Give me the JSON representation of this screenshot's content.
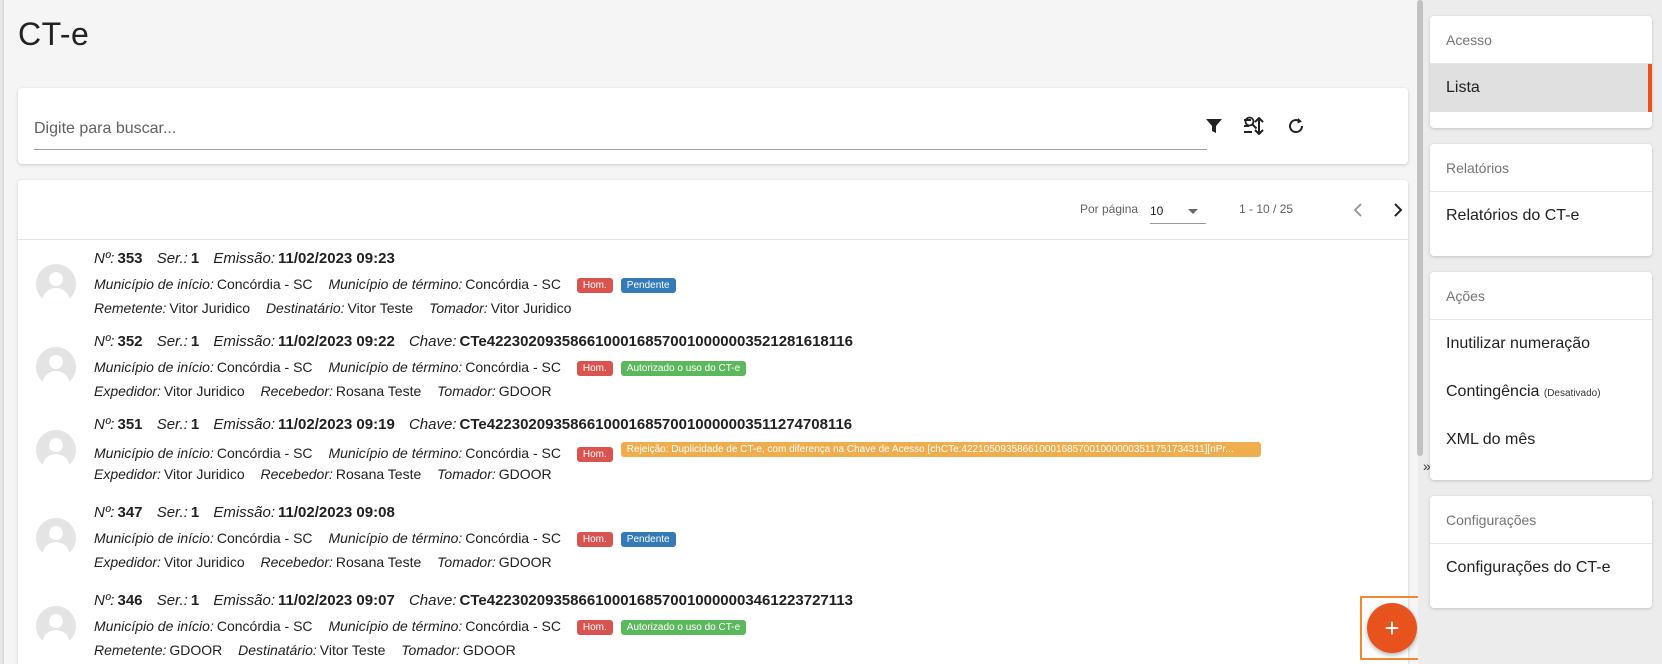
{
  "page": {
    "title": "CT-e"
  },
  "search": {
    "placeholder": "Digite para buscar..."
  },
  "pager": {
    "per_page_label": "Por página",
    "per_page_value": "10",
    "range": "1 - 10 / 25"
  },
  "items": [
    {
      "numero_label": "Nº:",
      "numero": "353",
      "serie_label": "Ser.:",
      "serie": "1",
      "emissao_label": "Emissão:",
      "emissao": "11/02/2023 09:23",
      "chave_label": "",
      "chave": "",
      "mun_inicio_label": "Município de início:",
      "mun_inicio": "Concórdia - SC",
      "mun_termino_label": "Município de término:",
      "mun_termino": "Concórdia - SC",
      "badge_env": "Hom.",
      "status": "Pendente",
      "p1_label": "Remetente:",
      "p1": "Vitor Juridico",
      "p2_label": "Destinatário:",
      "p2": "Vitor Teste",
      "p3_label": "Tomador:",
      "p3": "Vitor Juridico"
    },
    {
      "numero_label": "Nº:",
      "numero": "352",
      "serie_label": "Ser.:",
      "serie": "1",
      "emissao_label": "Emissão:",
      "emissao": "11/02/2023 09:22",
      "chave_label": "Chave:",
      "chave": "CTe42230209358661000168570010000003521281618116",
      "mun_inicio_label": "Município de início:",
      "mun_inicio": "Concórdia - SC",
      "mun_termino_label": "Município de término:",
      "mun_termino": "Concórdia - SC",
      "badge_env": "Hom.",
      "status": "Autorizado o uso do CT-e",
      "p1_label": "Expedidor:",
      "p1": "Vitor Juridico",
      "p2_label": "Recebedor:",
      "p2": "Rosana Teste",
      "p3_label": "Tomador:",
      "p3": "GDOOR"
    },
    {
      "numero_label": "Nº:",
      "numero": "351",
      "serie_label": "Ser.:",
      "serie": "1",
      "emissao_label": "Emissão:",
      "emissao": "11/02/2023 09:19",
      "chave_label": "Chave:",
      "chave": "CTe42230209358661000168570010000003511274708116",
      "mun_inicio_label": "Município de início:",
      "mun_inicio": "Concórdia - SC",
      "mun_termino_label": "Município de término:",
      "mun_termino": "Concórdia - SC",
      "badge_env": "Hom.",
      "status": "Rejeição: Duplicidade de CT-e, com diferença na Chave de Acesso [chCTe:42210509358661000168570010000003511751734311][nPr...",
      "p1_label": "Expedidor:",
      "p1": "Vitor Juridico",
      "p2_label": "Recebedor:",
      "p2": "Rosana Teste",
      "p3_label": "Tomador:",
      "p3": "GDOOR"
    },
    {
      "numero_label": "Nº:",
      "numero": "347",
      "serie_label": "Ser.:",
      "serie": "1",
      "emissao_label": "Emissão:",
      "emissao": "11/02/2023 09:08",
      "chave_label": "",
      "chave": "",
      "mun_inicio_label": "Município de início:",
      "mun_inicio": "Concórdia - SC",
      "mun_termino_label": "Município de término:",
      "mun_termino": "Concórdia - SC",
      "badge_env": "Hom.",
      "status": "Pendente",
      "p1_label": "Expedidor:",
      "p1": "Vitor Juridico",
      "p2_label": "Recebedor:",
      "p2": "Rosana Teste",
      "p3_label": "Tomador:",
      "p3": "GDOOR"
    },
    {
      "numero_label": "Nº:",
      "numero": "346",
      "serie_label": "Ser.:",
      "serie": "1",
      "emissao_label": "Emissão:",
      "emissao": "11/02/2023 09:07",
      "chave_label": "Chave:",
      "chave": "CTe42230209358661000168570010000003461223727113",
      "mun_inicio_label": "Município de início:",
      "mun_inicio": "Concórdia - SC",
      "mun_termino_label": "Município de término:",
      "mun_termino": "Concórdia - SC",
      "badge_env": "Hom.",
      "status": "Autorizado o uso do CT-e",
      "p1_label": "Remetente:",
      "p1": "GDOOR",
      "p2_label": "Destinatário:",
      "p2": "Vitor Teste",
      "p3_label": "Tomador:",
      "p3": "GDOOR"
    }
  ],
  "sidebar": {
    "acesso": {
      "heading": "Acesso",
      "items": [
        "Lista"
      ]
    },
    "relatorios": {
      "heading": "Relatórios",
      "items": [
        "Relatórios do CT-e"
      ]
    },
    "acoes": {
      "heading": "Ações",
      "items": [
        "Inutilizar numeração",
        "Contingência",
        "XML do mês"
      ],
      "contingencia_note": "(Desativado)"
    },
    "configuracoes": {
      "heading": "Configurações",
      "items": [
        "Configurações do CT-e"
      ]
    }
  },
  "icons": {
    "search": "search-icon",
    "filter": "filter-icon",
    "sort": "sort-icon",
    "refresh": "refresh-icon",
    "prev": "chevron-left-icon",
    "next": "chevron-right-icon",
    "add": "plus-icon",
    "collapse": "double-chevron-right-icon"
  },
  "fab": {
    "label": "+"
  },
  "collapse_label": "»",
  "colors": {
    "accent": "#e8521d",
    "hom": "#d9534f",
    "pendente": "#337ab7",
    "autorizado": "#5cb85c",
    "rejeicao": "#f0ad4e"
  }
}
